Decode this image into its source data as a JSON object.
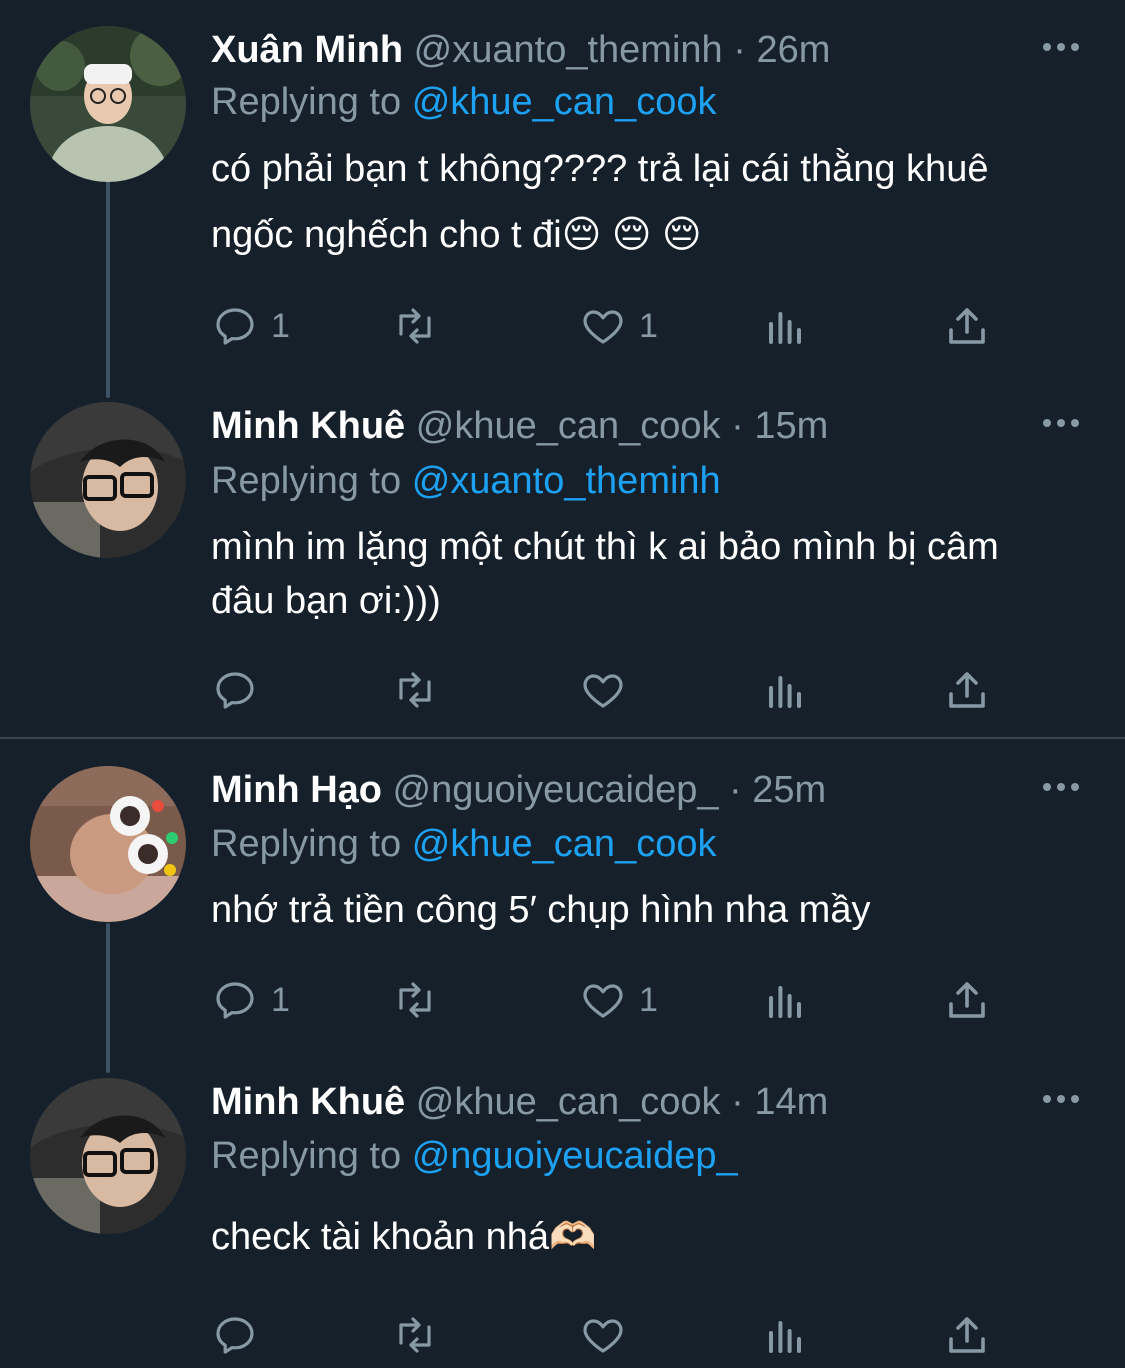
{
  "tweets": [
    {
      "name": "Xuân Minh",
      "handle": "@xuanto_theminh",
      "time": "26m",
      "replying_prefix": "Replying to",
      "replying_to": "@khue_can_cook",
      "text": "có phải bạn t không???? trả lại cái thằng khuê ngốc nghếch cho t đi😔 😔 😔",
      "reply_count": "1",
      "retweet_count": "",
      "like_count": "1"
    },
    {
      "name": "Minh Khuê",
      "handle": "@khue_can_cook",
      "time": "15m",
      "replying_prefix": "Replying to",
      "replying_to": "@xuanto_theminh",
      "text": "mình im lặng một chút thì k ai bảo mình bị câm đâu bạn ơi:)))",
      "reply_count": "",
      "retweet_count": "",
      "like_count": ""
    },
    {
      "name": "Minh Hạo",
      "handle": "@nguoiyeucaidep_",
      "time": "25m",
      "replying_prefix": "Replying to",
      "replying_to": "@khue_can_cook",
      "text": "nhớ trả tiền công 5′ chụp hình nha mầy",
      "reply_count": "1",
      "retweet_count": "",
      "like_count": "1"
    },
    {
      "name": "Minh Khuê",
      "handle": "@khue_can_cook",
      "time": "14m",
      "replying_prefix": "Replying to",
      "replying_to": "@nguoiyeucaidep_",
      "text": "check tài khoản nhá🫶🏻",
      "reply_count": "",
      "retweet_count": "",
      "like_count": ""
    }
  ],
  "separator": "·",
  "icons": [
    "reply-icon",
    "retweet-icon",
    "like-icon",
    "analytics-icon",
    "share-icon",
    "more-icon"
  ],
  "colors": {
    "background": "#15202b",
    "text": "#ffffff",
    "secondary": "#8899a6",
    "mention": "#1da1f2",
    "divider": "#38444d",
    "thread_line": "#3d5466"
  }
}
